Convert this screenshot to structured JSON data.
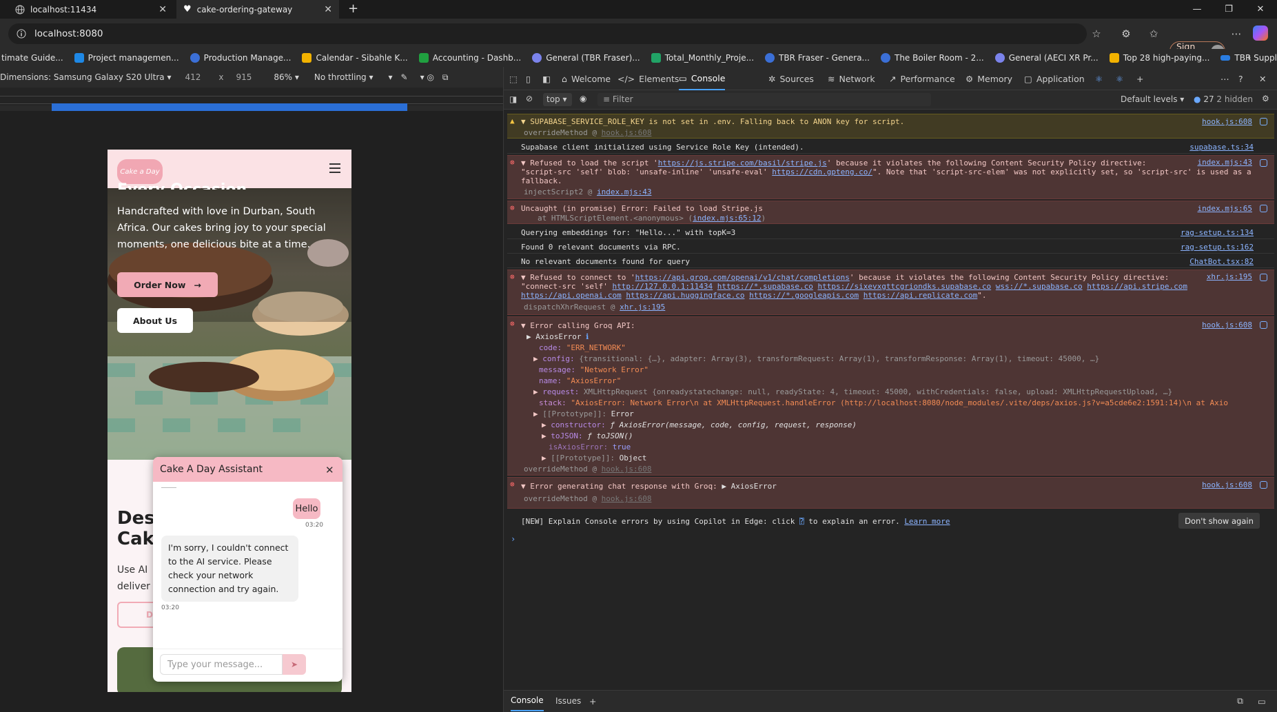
{
  "browser": {
    "tabs": [
      {
        "title": "localhost:11434"
      },
      {
        "title": "cake-ordering-gateway"
      }
    ],
    "url": "localhost:8080",
    "sign_in": "Sign in",
    "bookmarks": [
      "timate Guide...",
      "Project managemen...",
      "Production Manage...",
      "Calendar - Sibahle K...",
      "Accounting - Dashb...",
      "General (TBR Fraser)...",
      "Total_Monthly_Proje...",
      "TBR Fraser - Genera...",
      "The Boiler Room - 2...",
      "General (AECI XR Pr...",
      "Top 28 high-paying...",
      "TBR Suppliers - One..."
    ],
    "bookmark_colors": [
      "#3a78d8",
      "#1e88e5",
      "#3b6fd6",
      "#f2b200",
      "#20a040",
      "#7b83eb",
      "#21a366",
      "#3b6fd6",
      "#3b6fd6",
      "#7b83eb",
      "#f2b200",
      "#2a7de1"
    ]
  },
  "device_toolbar": {
    "dimensions": "Dimensions: Samsung Galaxy S20 Ultra",
    "width": "412",
    "times": "x",
    "height": "915",
    "zoom": "86%",
    "throttle": "No throttling"
  },
  "phone": {
    "logo": "Cake a Day",
    "hero_heading": "Every Occasion",
    "hero_text": "Handcrafted with love in Durban, South Africa. Our cakes bring joy to your special moments, one delicious bite at a time.",
    "order_now": "Order Now",
    "about_us": "About Us",
    "section_heading_1": "Des",
    "section_heading_2": "Cak",
    "section_text_1": "Use AI",
    "section_text_2": "deliver",
    "section_button": "Des"
  },
  "chat": {
    "title": "Cake A Day Assistant",
    "user_message": "Hello",
    "user_time": "03:20",
    "bot_message": "I'm sorry, I couldn't connect to the AI service. Please check your network connection and try again.",
    "bot_time": "03:20",
    "input_placeholder": "Type your message..."
  },
  "devtools": {
    "tabs": [
      "Welcome",
      "Elements",
      "Console",
      "Sources",
      "Network",
      "Performance",
      "Memory",
      "Application"
    ],
    "context": "top",
    "filter_placeholder": "Filter",
    "levels": "Default levels",
    "issue_count": "27",
    "hidden": "2 hidden",
    "drawer_tabs": [
      "Console",
      "Issues"
    ],
    "dont_show": "Don't show again",
    "messages": {
      "m1": {
        "text": "SUPABASE_SERVICE_ROLE_KEY is not set in .env. Falling back to ANON key for script.",
        "sub": "overrideMethod @ ",
        "sub_link": "hook.js:608",
        "src": "hook.js:608"
      },
      "m2": {
        "text": "Supabase client initialized using Service Role Key (intended).",
        "src": "supabase.ts:34"
      },
      "m3": {
        "l1a": "Refused to load the script '",
        "l1url": "https://js.stripe.com/basil/stripe.js",
        "l1b": "' because it violates the following Content Security Policy directive:",
        "l2a": "\"script-src 'self' blob: 'unsafe-inline' 'unsafe-eval' ",
        "l2url": "https://cdn.gpteng.co/",
        "l2b": "\". Note that 'script-src-elem' was not explicitly set, so 'script-src' is used as a",
        "l3": "fallback.",
        "sub": "injectScript2 @ ",
        "sub_link": "index.mjs:43",
        "src": "index.mjs:43"
      },
      "m4": {
        "text": "Uncaught (in promise) Error: Failed to load Stripe.js",
        "sub": "at HTMLScriptElement.<anonymous> (",
        "sub_link": "index.mjs:65:12",
        "sub_end": ")",
        "src": "index.mjs:65"
      },
      "m5": {
        "text": "Querying embeddings for: \"Hello...\" with topK=3",
        "src": "rag-setup.ts:134"
      },
      "m6": {
        "text": "Found 0 relevant documents via RPC.",
        "src": "rag-setup.ts:162"
      },
      "m7": {
        "text": "No relevant documents found for query",
        "src": "ChatBot.tsx:82"
      },
      "m8": {
        "l1a": "Refused to connect to '",
        "l1url": "https://api.groq.com/openai/v1/chat/completions",
        "l1b": "' because it violates the following Content Security Policy directive:",
        "l2a": "\"connect-src 'self' ",
        "l2urls": [
          "http://127.0.0.1:11434",
          "https://*.supabase.co",
          "https://sixevxgttcgriondks.supabase.co",
          "wss://*.supabase.co",
          "https://api.stripe.com"
        ],
        "l3urls": [
          "https://api.openai.com",
          "https://api.huggingface.co",
          "https://*.googleapis.com",
          "https://api.replicate.com"
        ],
        "l3end": "\".",
        "sub": "dispatchXhrRequest @ ",
        "sub_link": "xhr.js:195",
        "src": "xhr.js:195"
      },
      "m9": {
        "title": "Error calling Groq API:",
        "axios": "AxiosError",
        "code_k": "code:",
        "code_v": "\"ERR_NETWORK\"",
        "config_k": "config:",
        "config_v": "{transitional: {…}, adapter: Array(3), transformRequest: Array(1), transformResponse: Array(1), timeout: 45000, …}",
        "message_k": "message:",
        "message_v": "\"Network Error\"",
        "name_k": "name:",
        "name_v": "\"AxiosError\"",
        "request_k": "request:",
        "request_v": "XMLHttpRequest {onreadystatechange: null, readyState: 4, timeout: 45000, withCredentials: false, upload: XMLHttpRequestUpload, …}",
        "stack_k": "stack:",
        "stack_v": "\"AxiosError: Network Error\\n    at XMLHttpRequest.handleError (http://localhost:8080/node_modules/.vite/deps/axios.js?v=a5cde6e2:1591:14)\\n    at Axio",
        "proto_k": "[[Prototype]]:",
        "proto_v": "Error",
        "ctor_k": "constructor:",
        "ctor_v": "ƒ AxiosError(message, code, config, request, response)",
        "tojson_k": "toJSON:",
        "tojson_v": "ƒ toJSON()",
        "isaxios_k": "isAxiosError:",
        "isaxios_v": "true",
        "proto2_k": "[[Prototype]]:",
        "proto2_v": "Object",
        "sub": "overrideMethod @ ",
        "sub_link": "hook.js:608",
        "src": "hook.js:608"
      },
      "m10": {
        "title": "Error generating chat response with Groq:",
        "val": "AxiosError",
        "sub": "overrideMethod @ ",
        "sub_link": "hook.js:608",
        "src": "hook.js:608"
      },
      "m11": {
        "a": "[NEW] Explain Console errors by using Copilot in Edge: click",
        "b": "to explain an error.",
        "link": "Learn more"
      }
    }
  }
}
